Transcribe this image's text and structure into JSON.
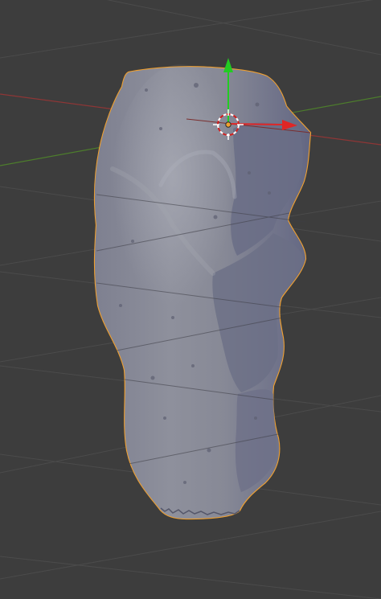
{
  "viewport": {
    "kind": "3d-viewport",
    "background_color": "#3d3d3d",
    "grid_color": "#4a4a4a",
    "x_axis_color": "#a33a3a",
    "y_axis_color": "#4f8f2a",
    "selection_outline_color": "#f0a030"
  },
  "mesh": {
    "name_icon": "rock-mesh",
    "base_color": "#8c8d96",
    "shade_color": "#6b6d80",
    "highlight_color": "#b0b2bc",
    "selected": true
  },
  "origin": {
    "icon": "object-origin-dot",
    "color": "#f0a030"
  },
  "cursor_3d": {
    "icon": "3d-cursor-icon",
    "ring_colors": [
      "#ffffff",
      "#d02020"
    ]
  },
  "gizmo": {
    "x_arrow_color": "#e02626",
    "y_arrow_color": "#22cc22",
    "x_arrow_icon": "x-axis-arrow-icon",
    "y_arrow_icon": "y-axis-arrow-icon"
  }
}
